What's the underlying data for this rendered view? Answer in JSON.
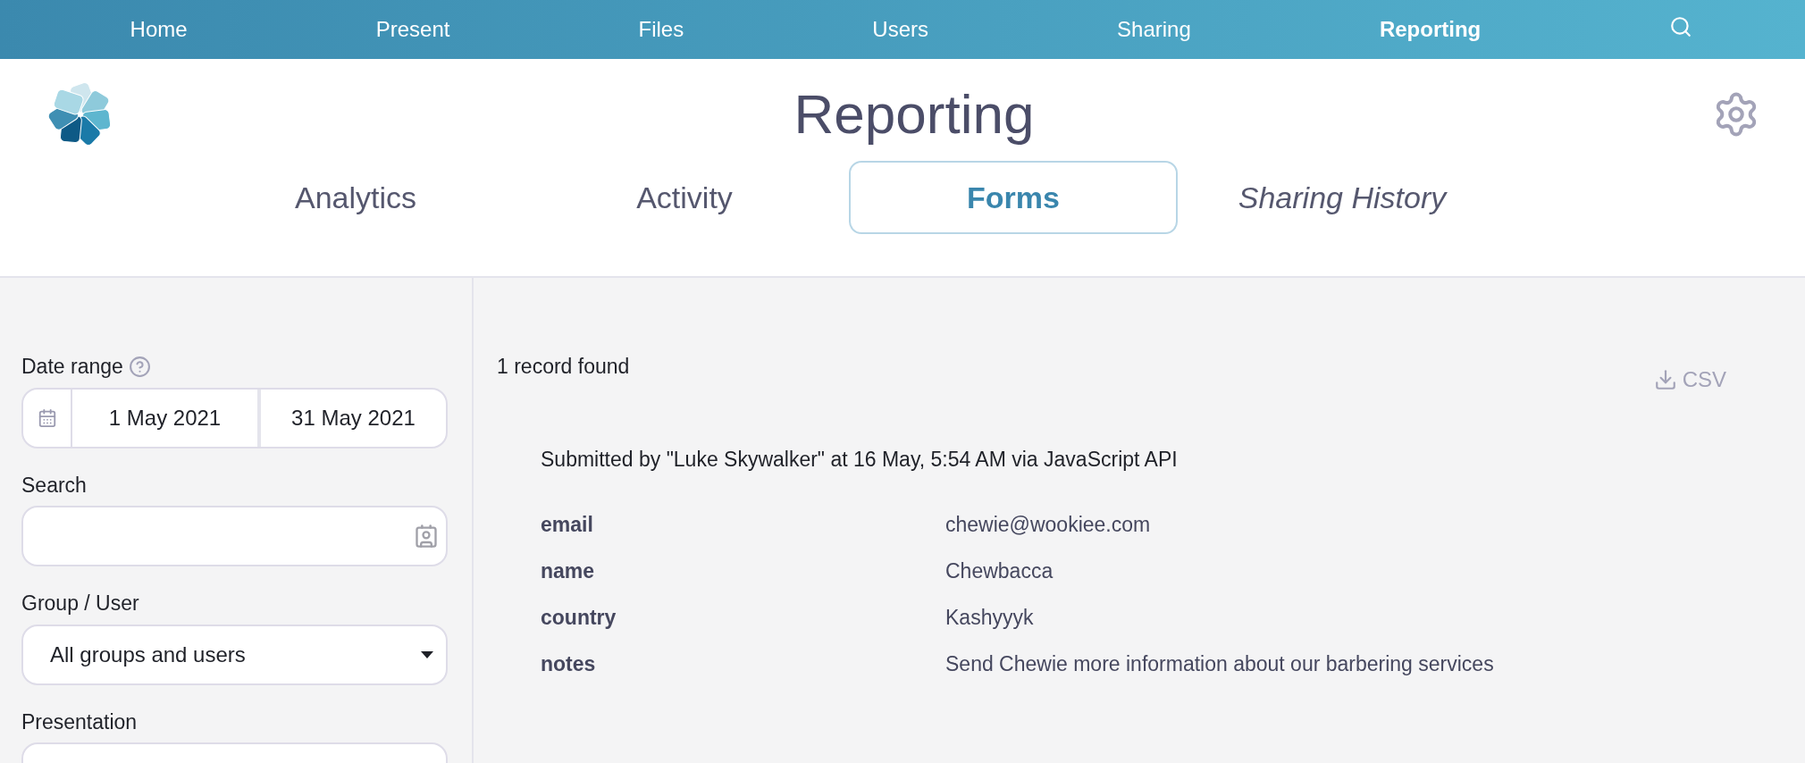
{
  "nav": [
    {
      "label": "Home",
      "selected": false
    },
    {
      "label": "Present",
      "selected": false
    },
    {
      "label": "Files",
      "selected": false
    },
    {
      "label": "Users",
      "selected": false
    },
    {
      "label": "Sharing",
      "selected": false
    },
    {
      "label": "Reporting",
      "selected": true
    }
  ],
  "header": {
    "title": "Reporting"
  },
  "tabs": [
    {
      "label": "Analytics",
      "selected": false,
      "italic": false
    },
    {
      "label": "Activity",
      "selected": false,
      "italic": false
    },
    {
      "label": "Forms",
      "selected": true,
      "italic": false
    },
    {
      "label": "Sharing History",
      "selected": false,
      "italic": true
    }
  ],
  "filters": {
    "date_range": {
      "label": "Date range",
      "start": "1 May 2021",
      "end": "31 May 2021"
    },
    "search": {
      "label": "Search"
    },
    "group_user": {
      "label": "Group / User",
      "value": "All groups and users"
    },
    "presentation": {
      "label": "Presentation"
    }
  },
  "results": {
    "count": "1 record found",
    "export": "CSV",
    "submission": {
      "summary": "Submitted by \"Luke Skywalker\" at 16 May, 5:54 AM via JavaScript API",
      "fields": [
        {
          "name": "email",
          "value": "chewie@wookiee.com"
        },
        {
          "name": "name",
          "value": "Chewbacca"
        },
        {
          "name": "country",
          "value": "Kashyyyk"
        },
        {
          "name": "notes",
          "value": "Send Chewie more information about our barbering services"
        }
      ]
    }
  }
}
